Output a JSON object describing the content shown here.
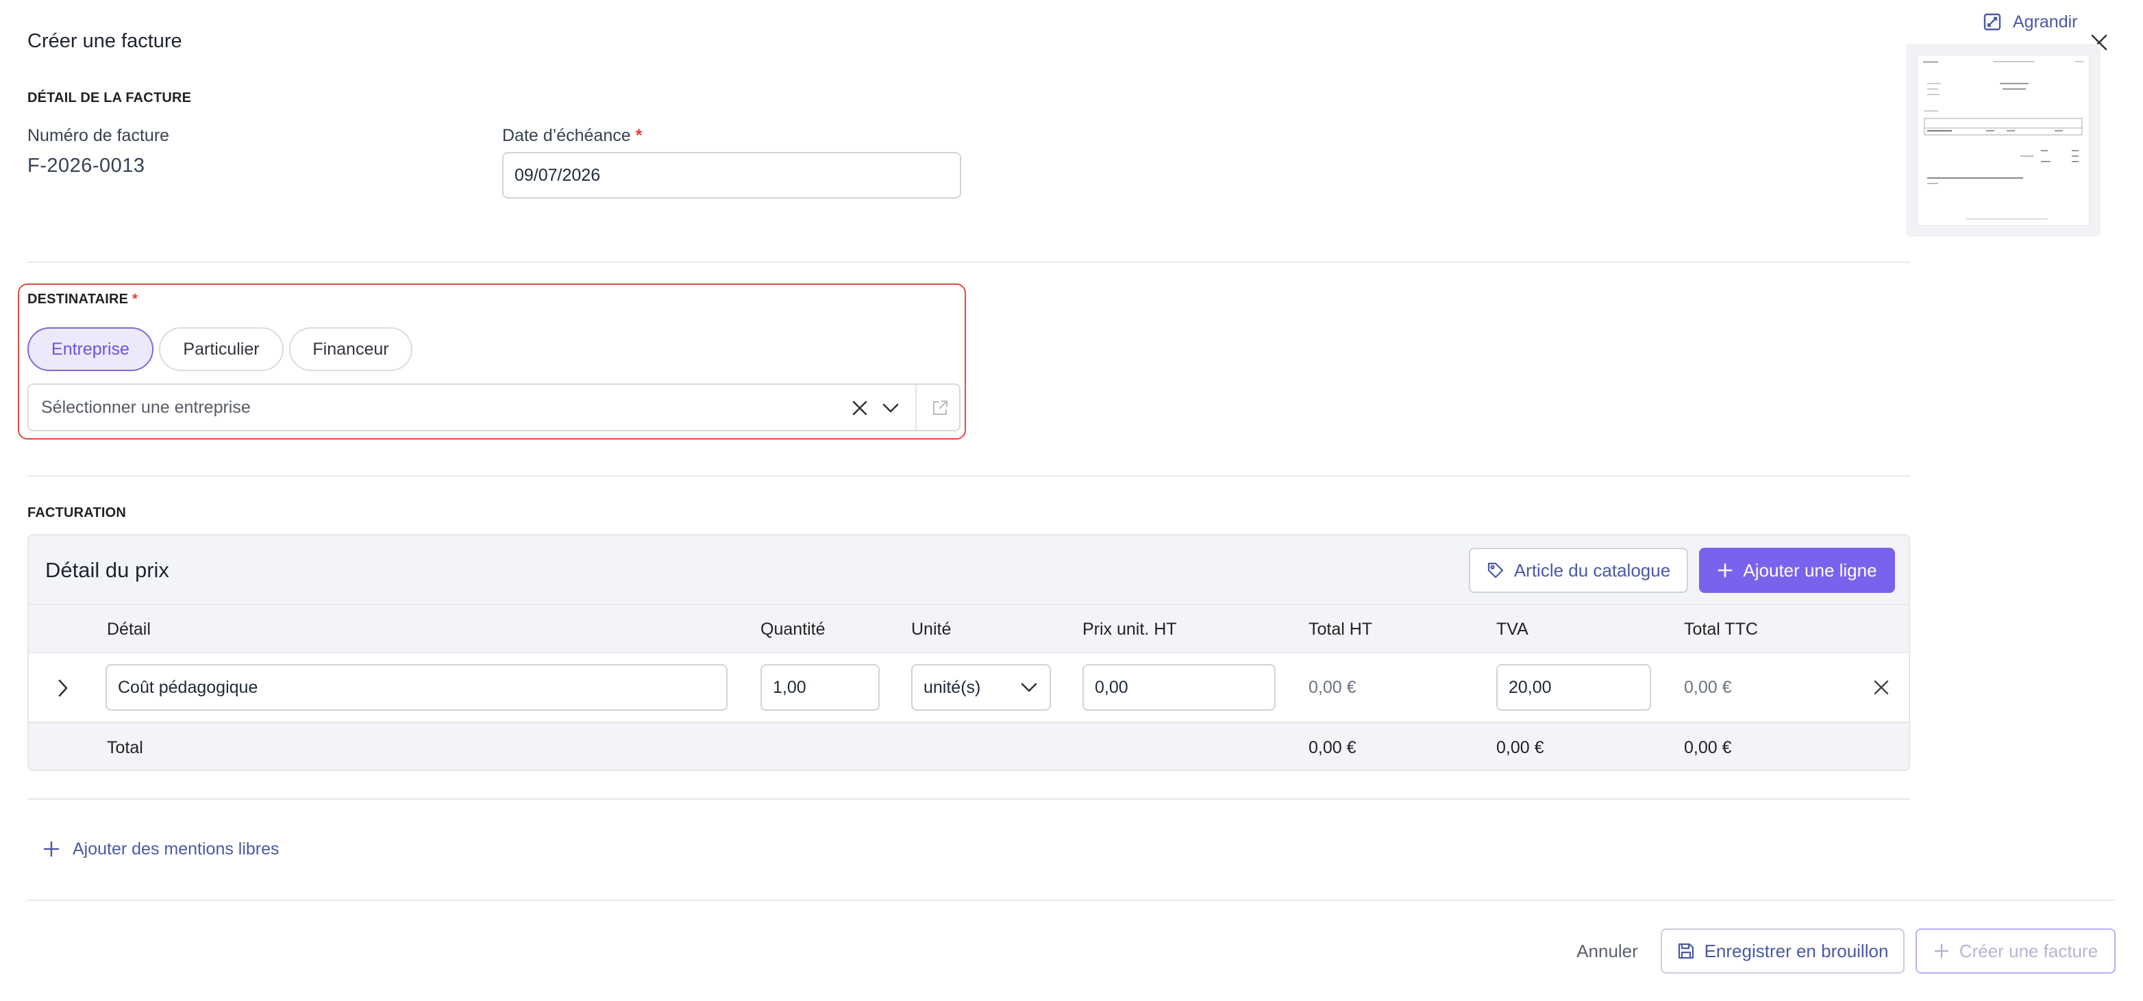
{
  "modal": {
    "title": "Créer une facture",
    "expand_label": "Agrandir",
    "icons": {
      "expand": "expand-icon",
      "close": "close-icon"
    }
  },
  "invoice_detail": {
    "section_label": "DÉTAIL DE LA FACTURE",
    "number_label": "Numéro de facture",
    "number_value": "F-2026-0013",
    "due_date_label": "Date d’échéance",
    "due_date_value": "09/07/2026",
    "required_mark": "*"
  },
  "recipient": {
    "section_label": "DESTINATAIRE",
    "required_mark": "*",
    "types": [
      "Entreprise",
      "Particulier",
      "Financeur"
    ],
    "selected_type": "Entreprise",
    "select_placeholder": "Sélectionner une entreprise",
    "error_color": "#e04a3f"
  },
  "billing": {
    "section_label": "FACTURATION",
    "card_title": "Détail du prix",
    "catalog_button": "Article du catalogue",
    "add_line_button": "Ajouter une ligne",
    "columns": [
      "Détail",
      "Quantité",
      "Unité",
      "Prix unit. HT",
      "Total HT",
      "TVA",
      "Total TTC"
    ],
    "rows": [
      {
        "detail": "Coût pédagogique",
        "quantity": "1,00",
        "unit": "unité(s)",
        "unit_price": "0,00",
        "total_ht": "0,00 €",
        "tva": "20,00",
        "total_ttc": "0,00 €"
      }
    ],
    "total": {
      "label": "Total",
      "total_ht": "0,00 €",
      "tva": "0,00 €",
      "total_ttc": "0,00 €"
    }
  },
  "free_mentions_link": "Ajouter des mentions libres",
  "footer": {
    "cancel": "Annuler",
    "save_draft": "Enregistrer en brouillon",
    "create": "Créer une facture"
  },
  "colors": {
    "accent": "#7a63ec",
    "link": "#4a58a8",
    "error": "#e04a3f"
  }
}
